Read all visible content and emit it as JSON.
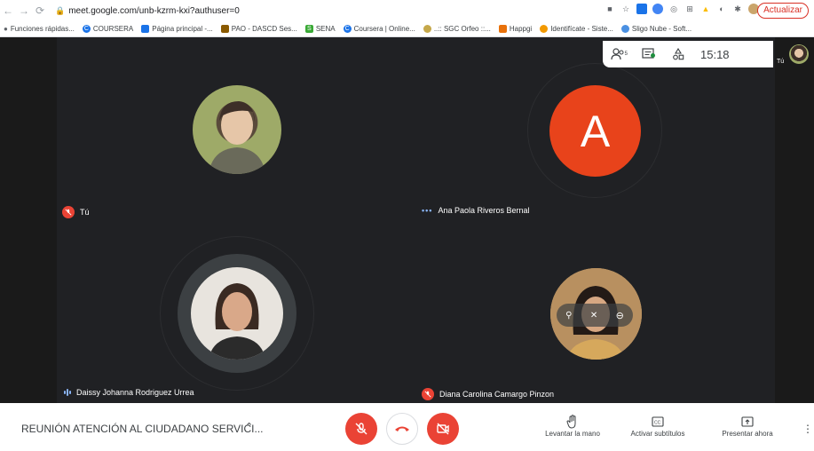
{
  "browser": {
    "url": "meet.google.com/unb-kzrm-kxi?authuser=0",
    "update_label": "Actualizar",
    "bookmarks": [
      "Funciones rápidas...",
      "COURSERA",
      "Página principal -...",
      "PAO - DASCD Ses...",
      "SENA",
      "Coursera | Online...",
      "..:: SGC Orfeo ::...",
      "Happgi",
      "Identifícate - Siste...",
      "Sligo Nube - Soft..."
    ]
  },
  "participants": [
    {
      "name": "Tú",
      "status": "mic-off"
    },
    {
      "name": "Ana Paola Riveros Bernal",
      "status": "dots",
      "initial": "A"
    },
    {
      "name": "Daissy Johanna Rodriguez Urrea",
      "status": "speaking"
    },
    {
      "name": "Diana Carolina Camargo Pinzon",
      "status": "mic-off"
    }
  ],
  "info_panel": {
    "people_count": "5",
    "clock": "15:18",
    "self_label": "Tú"
  },
  "bottom": {
    "meeting_title": "REUNIÓN ATENCIÓN AL CIUDADANO SERVICI...",
    "raise_hand": "Levantar la mano",
    "captions": "Activar subtítulos",
    "present": "Presentar ahora"
  },
  "colors": {
    "accent_red": "#ea4335",
    "avatar_orange": "#e8431b",
    "stage_bg": "#202124"
  }
}
